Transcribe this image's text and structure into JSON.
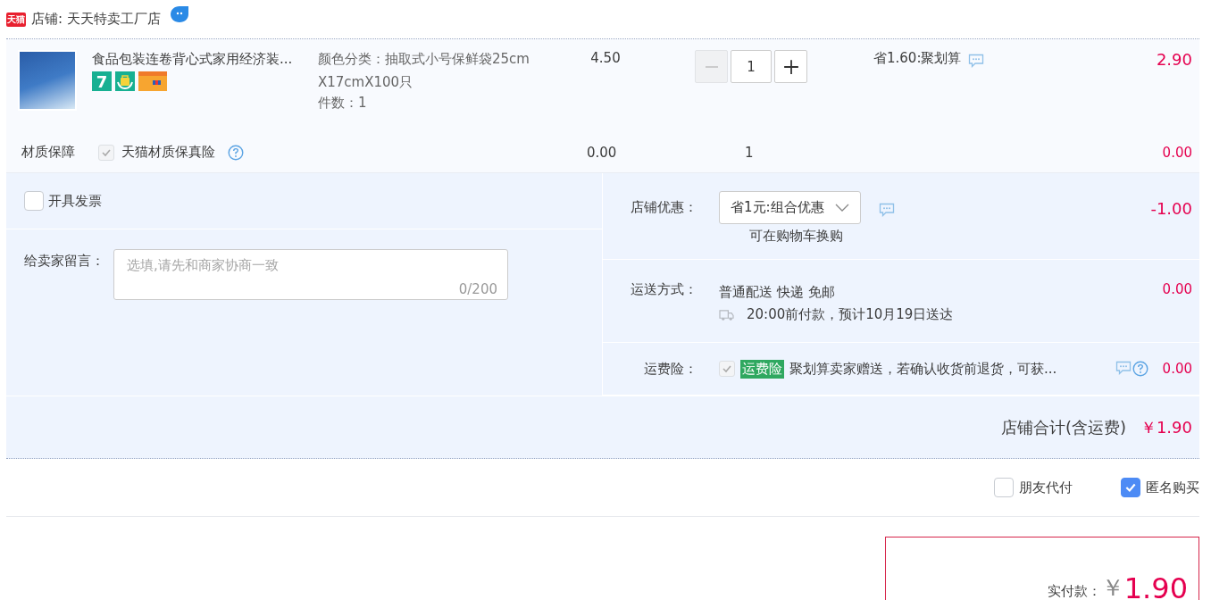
{
  "store": {
    "logo": "天猫",
    "label": "店铺: 天天特卖工厂店"
  },
  "item": {
    "title": "食品包装连卷背心式家用经济装...",
    "tags": [
      {
        "kind": "text",
        "label": "7"
      },
      {
        "kind": "bag"
      },
      {
        "kind": "card"
      }
    ],
    "sku": "颜色分类：抽取式小号保鲜袋25cmX17cmX100只",
    "count": "件数：1",
    "price": "4.50",
    "quantity": "1",
    "decrease_disabled": true,
    "promo": "省1.60:聚划算",
    "subtotal": "2.90"
  },
  "service": {
    "label": "材质保障",
    "checked": true,
    "disabled": true,
    "name": "天猫材质保真险",
    "price": "0.00",
    "quantity": "1",
    "subtotal": "0.00"
  },
  "invoice": {
    "label": "开具发票",
    "checked": false
  },
  "message": {
    "label": "给卖家留言：",
    "placeholder": "选填,请先和商家协商一致",
    "counter": "0/200"
  },
  "discount": {
    "label": "店铺优惠：",
    "value": "省1元:组合优惠",
    "note": "可在购物车换购",
    "amount": "-1.00"
  },
  "shipping": {
    "label": "运送方式：",
    "method": "普通配送 快递 免邮",
    "eta": "20:00前付款，预计10月19日送达",
    "amount": "0.00"
  },
  "insurance": {
    "label": "运费险：",
    "checked": true,
    "disabled": true,
    "tag": "运费险",
    "text": "聚划算卖家赠送，若确认收货前退货，可获...",
    "amount": "0.00"
  },
  "total": {
    "label": "店铺合计(含运费)",
    "amount": "￥1.90"
  },
  "options": [
    {
      "label": "朋友代付",
      "checked": false
    },
    {
      "label": "匿名购买",
      "checked": true
    }
  ],
  "pay": {
    "label": "实付款：",
    "currency": "￥",
    "amount": "1.90"
  }
}
